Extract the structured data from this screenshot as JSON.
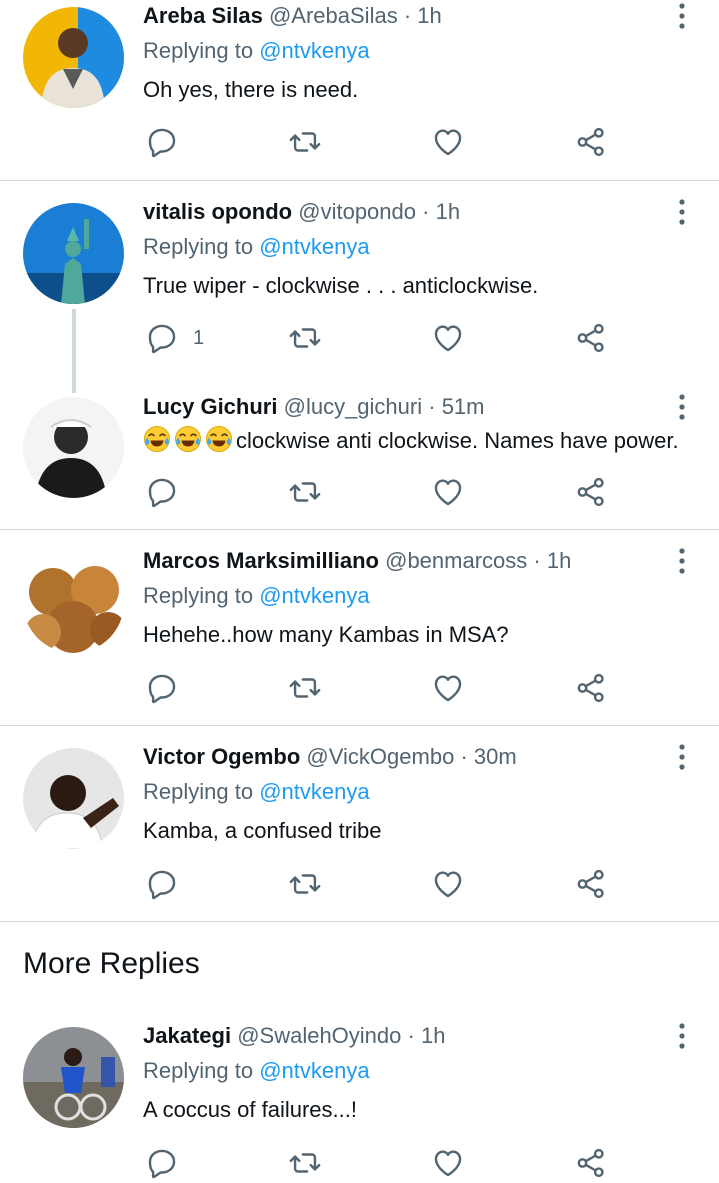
{
  "colors": {
    "accent": "#1d9bf0",
    "secondary_text": "#536471",
    "divider": "#cfd9de"
  },
  "tweets": [
    {
      "name": "Areba Silas",
      "handle": "@ArebaSilas",
      "dot": "·",
      "time": "1h",
      "replying_prefix": "Replying to",
      "replying_to": "@ntvkenya",
      "text": "Oh yes, there is need.",
      "reply_count": ""
    },
    {
      "name": "vitalis opondo",
      "handle": "@vitopondo",
      "dot": "·",
      "time": "1h",
      "replying_prefix": "Replying to",
      "replying_to": "@ntvkenya",
      "text": "True wiper - clockwise . . . anticlockwise.",
      "reply_count": "1"
    },
    {
      "name": "Lucy Gichuri",
      "handle": "@lucy_gichuri",
      "dot": "·",
      "time": "51m",
      "text": "clockwise anti clockwise. Names have power.",
      "emoji_prefix": "face-with-tears-of-joy x3",
      "reply_count": ""
    },
    {
      "name": "Marcos Marksimilliano",
      "handle": "@benmarcoss",
      "dot": "·",
      "time": "1h",
      "replying_prefix": "Replying to",
      "replying_to": "@ntvkenya",
      "text": "Hehehe..how many Kambas in MSA?",
      "reply_count": ""
    },
    {
      "name": "Victor Ogembo",
      "handle": "@VickOgembo",
      "dot": "·",
      "time": "30m",
      "replying_prefix": "Replying to",
      "replying_to": "@ntvkenya",
      "text": "Kamba, a confused tribe",
      "reply_count": ""
    }
  ],
  "more_replies": {
    "title": "More Replies",
    "tweets": [
      {
        "name": "Jakategi",
        "handle": "@SwalehOyindo",
        "dot": "·",
        "time": "1h",
        "replying_prefix": "Replying to",
        "replying_to": "@ntvkenya",
        "text": "A coccus of failures...!"
      }
    ]
  },
  "icons": [
    "reply-icon",
    "retweet-icon",
    "like-icon",
    "share-icon",
    "more-options-icon"
  ]
}
